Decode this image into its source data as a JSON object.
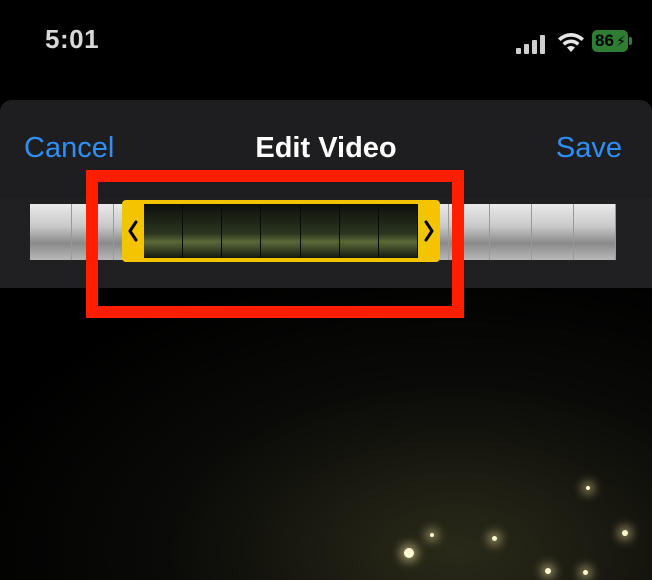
{
  "status_bar": {
    "time": "5:01",
    "battery": "86",
    "icons": [
      "cellular-signal-icon",
      "wifi-icon",
      "battery-charging-icon"
    ]
  },
  "nav": {
    "cancel_label": "Cancel",
    "title": "Edit Video",
    "save_label": "Save"
  },
  "colors": {
    "accent": "#2f8ff5",
    "trim_handle": "#f5c400",
    "highlight": "#ff1e00",
    "battery": "#2e7d32"
  }
}
